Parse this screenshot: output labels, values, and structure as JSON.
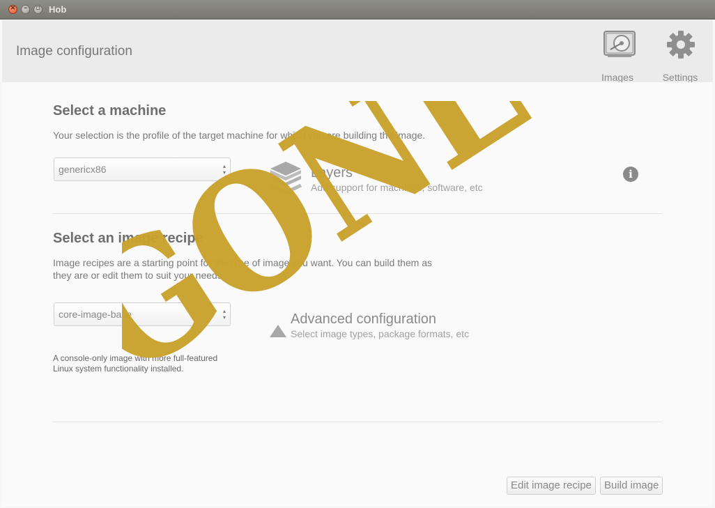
{
  "window": {
    "title": "Hob"
  },
  "header": {
    "title": "Image configuration",
    "images_label": "Images",
    "settings_label": "Settings"
  },
  "machine": {
    "heading": "Select a machine",
    "description": "Your selection is the profile of the target machine for which you are building the image.",
    "selected": "genericx86"
  },
  "layers": {
    "title": "Layers",
    "subtitle": "Add support for machines, software, etc"
  },
  "recipe": {
    "heading": "Select an image recipe",
    "description_line1": "Image recipes are a starting point for the type of image you want. You can build them as",
    "description_line2": "they are or edit them to suit your needs.",
    "selected": "core-image-base",
    "recipe_description_line1": "A console-only image with more full-featured",
    "recipe_description_line2": "Linux system functionality installed."
  },
  "advanced": {
    "title": "Advanced configuration",
    "subtitle": "Select image types, package formats, etc"
  },
  "footer": {
    "edit_button": "Edit image recipe",
    "build_button": "Build image"
  },
  "watermark": {
    "text": "GONE",
    "color": "#c9a22d"
  },
  "icons": {
    "images": "hard-drive-icon",
    "settings": "gear-icon",
    "layers": "layers-icon",
    "info": "info-icon"
  }
}
